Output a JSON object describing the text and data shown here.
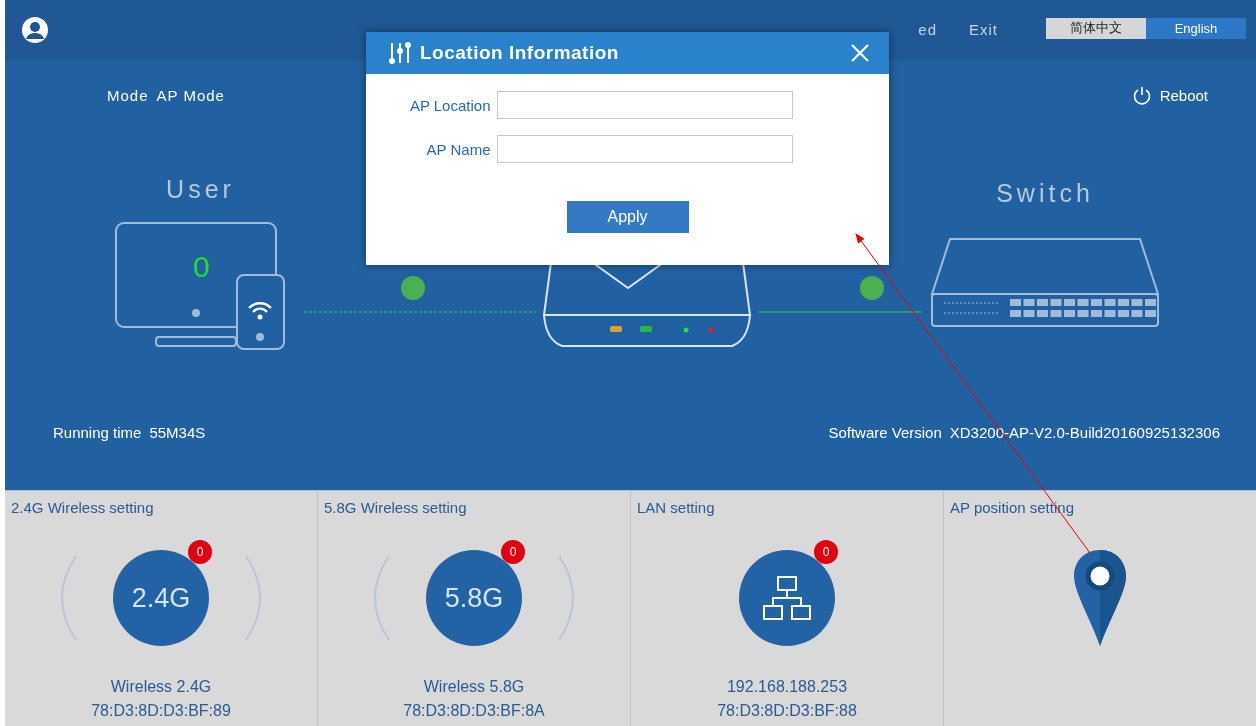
{
  "header": {
    "nav": [
      {
        "label": "ed"
      },
      {
        "label": "Exit"
      }
    ],
    "languages": [
      {
        "label": "简体中文",
        "selected": false
      },
      {
        "label": "English",
        "selected": true
      }
    ]
  },
  "status": {
    "mode_label": "Mode",
    "mode_value": "AP Mode",
    "reboot": "Reboot",
    "user_label": "User",
    "user_count": "0",
    "switch_label": "Switch",
    "running_time_label": "Running time",
    "running_time": "55M34S",
    "software_version_label": "Software Version",
    "software_version": "XD3200-AP-V2.0-Build20160925132306"
  },
  "cards": [
    {
      "kind": "wireless",
      "title": "2.4G Wireless setting",
      "icon_text": "2.4G",
      "badge": "0",
      "name": "Wireless 2.4G",
      "mac": "78:D3:8D:D3:BF:89"
    },
    {
      "kind": "wireless",
      "title": "5.8G Wireless setting",
      "icon_text": "5.8G",
      "badge": "0",
      "name": "Wireless 5.8G",
      "mac": "78:D3:8D:D3:BF:8A"
    },
    {
      "kind": "lan",
      "title": "LAN setting",
      "badge": "0",
      "name": "192.168.188.253",
      "mac": "78:D3:8D:D3:BF:88"
    },
    {
      "kind": "position",
      "title": "AP position setting"
    }
  ],
  "dialog": {
    "title": "Location Information",
    "fields": [
      {
        "label": "AP Location"
      },
      {
        "label": "AP Name"
      }
    ],
    "button": "Apply"
  }
}
